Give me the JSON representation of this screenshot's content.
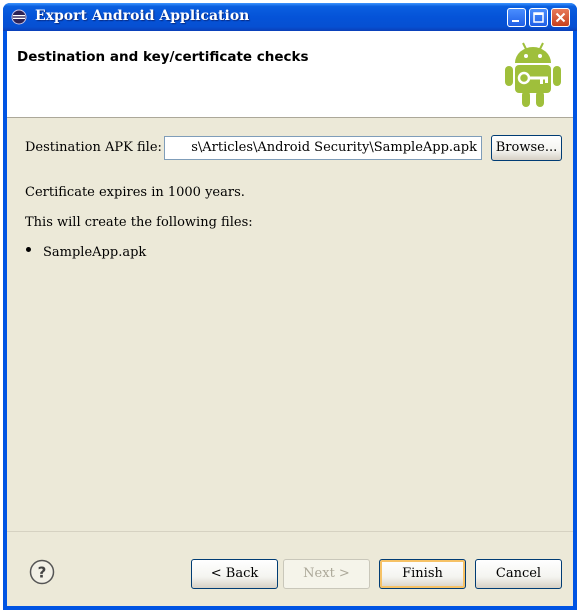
{
  "window": {
    "title": "Export Android Application"
  },
  "banner": {
    "title": "Destination and key/certificate checks",
    "icon": "android-robot-icon"
  },
  "form": {
    "destination_label": "Destination APK file:",
    "destination_value": "s\\Articles\\Android Security\\SampleApp.apk",
    "browse_label": "Browse..."
  },
  "info": {
    "certificate": "Certificate expires in 1000 years.",
    "files_intro": "This will create the following files:",
    "files": [
      "SampleApp.apk"
    ]
  },
  "buttons": {
    "back": "< Back",
    "next": "Next >",
    "finish": "Finish",
    "cancel": "Cancel"
  },
  "colors": {
    "titlebar": "#0553d8",
    "dialog_bg": "#ece9d8",
    "android_green": "#9fbf3b"
  }
}
